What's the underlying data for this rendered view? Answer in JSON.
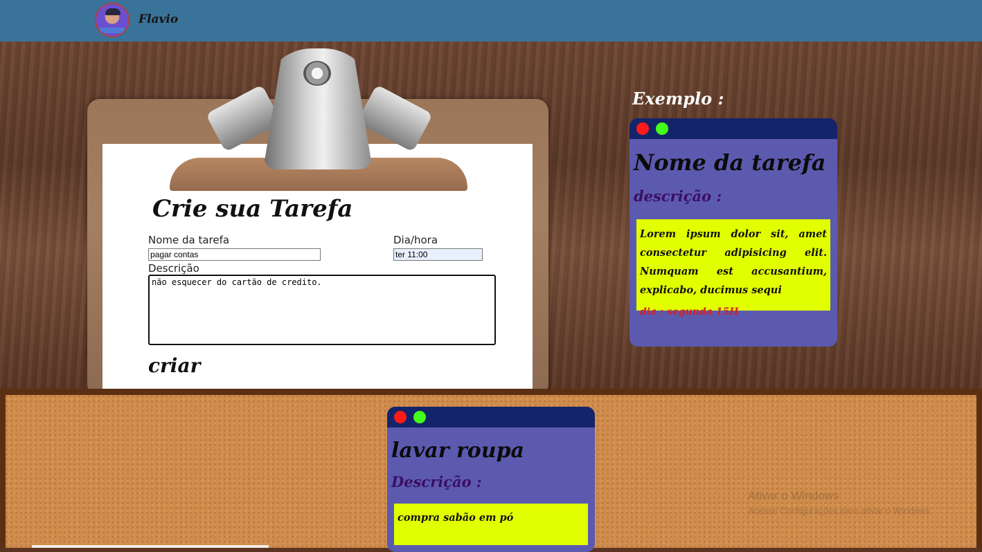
{
  "header": {
    "username": "Flavio",
    "avatar_icon": "user-avatar-icon",
    "bar_color": "#3a7399"
  },
  "form": {
    "title": "Crie sua Tarefa",
    "name_label": "Nome da tarefa",
    "name_value": "pagar contas",
    "date_label": "Dia/hora",
    "date_value": "ter 11:00",
    "desc_label": "Descrição",
    "desc_value": "não esquecer do cartão de credito.",
    "submit_label": "criar"
  },
  "example": {
    "label": "Exemplo :",
    "card": {
      "title": "Nome da tarefa",
      "desc_heading": "descrição :",
      "body": "Lorem ipsum dolor sit, amet consectetur adipisicing elit. Numquam est accusantium, explicabo, ducimus sequi",
      "due": "dia : segunda 15H"
    }
  },
  "board": {
    "tasks": [
      {
        "title": "lavar roupa",
        "desc_heading": "Descrição :",
        "body": "compra sabão em pó"
      }
    ]
  },
  "system": {
    "watermark_title": "Ativar o Windows",
    "watermark_sub": "Acesse Configurações para ativar o Windows."
  },
  "colors": {
    "card_bg": "#5c5aaf",
    "card_header": "#14246a",
    "note_bg": "#e2ff00",
    "close_dot": "#ff1a1a",
    "expand_dot": "#44ff19",
    "due_text": "#d0202a"
  }
}
